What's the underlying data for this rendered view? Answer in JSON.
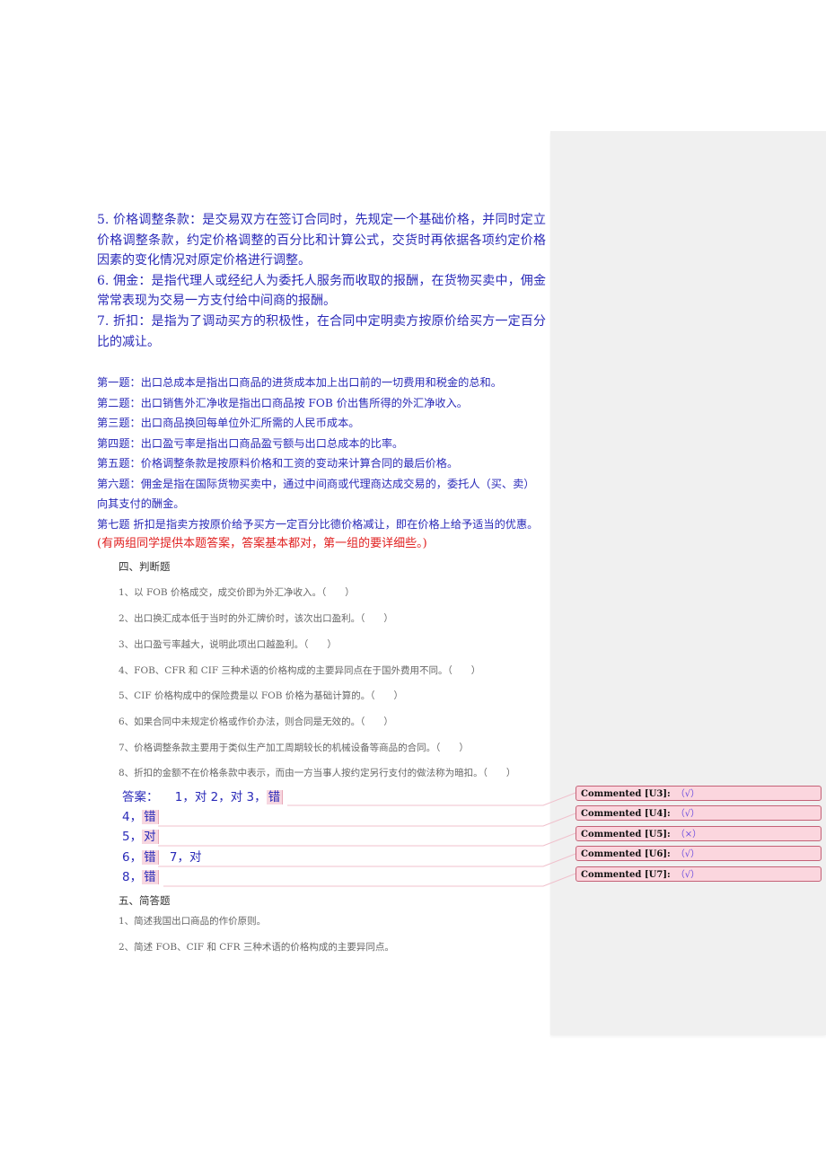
{
  "definitions": [
    "5. 价格调整条款：是交易双方在签订合同时，先规定一个基础价格，并同时定立价格调整条款，约定价格调整的百分比和计算公式，交货时再依据各项约定价格因素的变化情况对原定价格进行调整。",
    "6. 佣金：是指代理人或经纪人为委托人服务而收取的报酬，在货物买卖中，佣金常常表现为交易一方支付给中间商的报酬。",
    "7. 折扣：是指为了调动买方的积极性，在合同中定明卖方按原价给买方一定百分比的减让。"
  ],
  "group_answers": [
    "第一题：出口总成本是指出口商品的进货成本加上出口前的一切费用和税金的总和。",
    "第二题：出口销售外汇净收是指出口商品按 FOB 价出售所得的外汇净收入。",
    "第三题：出口商品换回每单位外汇所需的人民币成本。",
    "第四题：出口盈亏率是指出口商品盈亏额与出口总成本的比率。",
    "第五题：价格调整条款是按原料价格和工资的变动来计算合同的最后价格。",
    "第六题：佣金是指在国际货物买卖中，通过中间商或代理商达成交易的，委托人（买、卖）",
    "向其支付的酬金。",
    "第七题 折扣是指卖方按原价给予买方一定百分比德价格减让，即在价格上给予适当的优惠。"
  ],
  "note": "(有两组同学提供本题答案，答案基本都对，第一组的要详细些。)",
  "section4": {
    "title": "四、判断题",
    "items": [
      "1、以 FOB 价格成交，成交价即为外汇净收入。（　　）",
      "2、出口换汇成本低于当时的外汇牌价时，该次出口盈利。（　　）",
      "3、出口盈亏率越大，说明此项出口越盈利。（　　）",
      "4、FOB、CFR 和 CIF 三种术语的价格构成的主要异同点在于国外费用不同。（　　）",
      "5、CIF 价格构成中的保险费是以 FOB 价格为基础计算的。（　　）",
      "6、如果合同中未规定价格或作价办法，则合同是无效的。（　　）",
      "7、价格调整条款主要用于类似生产加工周期较长的机械设备等商品的合同。（　　）",
      "8、折扣的金额不在价格条款中表示，而由一方当事人按约定另行支付的做法称为暗扣。（　　）"
    ]
  },
  "answers": {
    "label": "答案：",
    "line1_prefix": "1，对 2，对 3，",
    "line1_hl": "错",
    "line2_prefix": "4，",
    "line2_hl": "错",
    "line3_prefix": "5，",
    "line3_hl": "对",
    "line4_prefix": "6，",
    "line4_hl": "错",
    "line4_suffix": "7，对",
    "line5_prefix": "8，",
    "line5_hl": "错"
  },
  "comments": [
    {
      "label": "Commented [U3]:",
      "text": "（√）"
    },
    {
      "label": "Commented [U4]:",
      "text": "（√）"
    },
    {
      "label": "Commented [U5]:",
      "text": "（×）"
    },
    {
      "label": "Commented [U6]:",
      "text": "（√）"
    },
    {
      "label": "Commented [U7]:",
      "text": "（√）"
    }
  ],
  "section5": {
    "title": "五、简答题",
    "items": [
      "1、简述我国出口商品的作价原则。",
      "2、简述 FOB、CIF 和 CFR 三种术语的价格构成的主要异同点。"
    ]
  }
}
